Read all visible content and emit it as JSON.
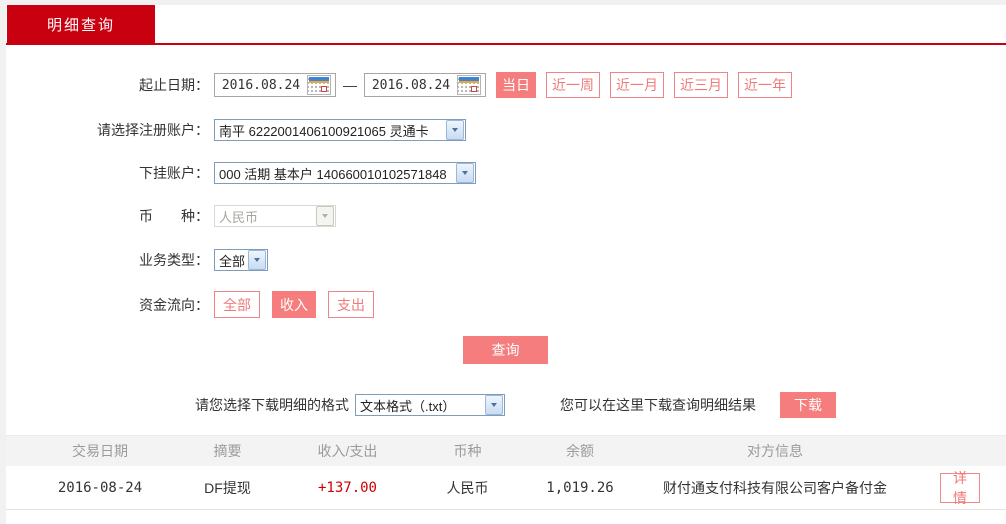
{
  "page": {
    "tab_title": "明细查询"
  },
  "colors": {
    "brand_red": "#c8000f",
    "accent_salmon": "#f57d7d",
    "amount_red": "#cc0000"
  },
  "form": {
    "date_range": {
      "label": "起止日期：",
      "start_value": "2016.08.24",
      "end_value": "2016.08.24",
      "separator": "—"
    },
    "quick_ranges": [
      {
        "label": "当日",
        "active": true
      },
      {
        "label": "近一周",
        "active": false
      },
      {
        "label": "近一月",
        "active": false
      },
      {
        "label": "近三月",
        "active": false
      },
      {
        "label": "近一年",
        "active": false
      }
    ],
    "registered_account": {
      "label": "请选择注册账户：",
      "value": "南平 6222001406100921065 灵通卡"
    },
    "sub_account": {
      "label": "下挂账户：",
      "value": "000 活期 基本户 140660010102571848"
    },
    "currency": {
      "label": "币　　种：",
      "value": "人民币",
      "disabled": true
    },
    "business_type": {
      "label": "业务类型：",
      "value": "全部"
    },
    "fund_flow": {
      "label": "资金流向：",
      "options": [
        {
          "label": "全部",
          "active": false
        },
        {
          "label": "收入",
          "active": true
        },
        {
          "label": "支出",
          "active": false
        }
      ]
    },
    "query_button_label": "查询"
  },
  "download": {
    "format_label": "请您选择下载明细的格式",
    "format_value": "文本格式（.txt）",
    "hint": "您可以在这里下载查询明细结果",
    "button_label": "下载"
  },
  "table": {
    "headers": [
      "交易日期",
      "摘要",
      "收入/支出",
      "币种",
      "余额",
      "对方信息"
    ],
    "rows": [
      {
        "date": "2016-08-24",
        "summary": "DF提现",
        "amount": "+137.00",
        "currency": "人民币",
        "balance": "1,019.26",
        "counterparty": "财付通支付科技有限公司客户备付金",
        "detail_label": "详情"
      }
    ]
  }
}
